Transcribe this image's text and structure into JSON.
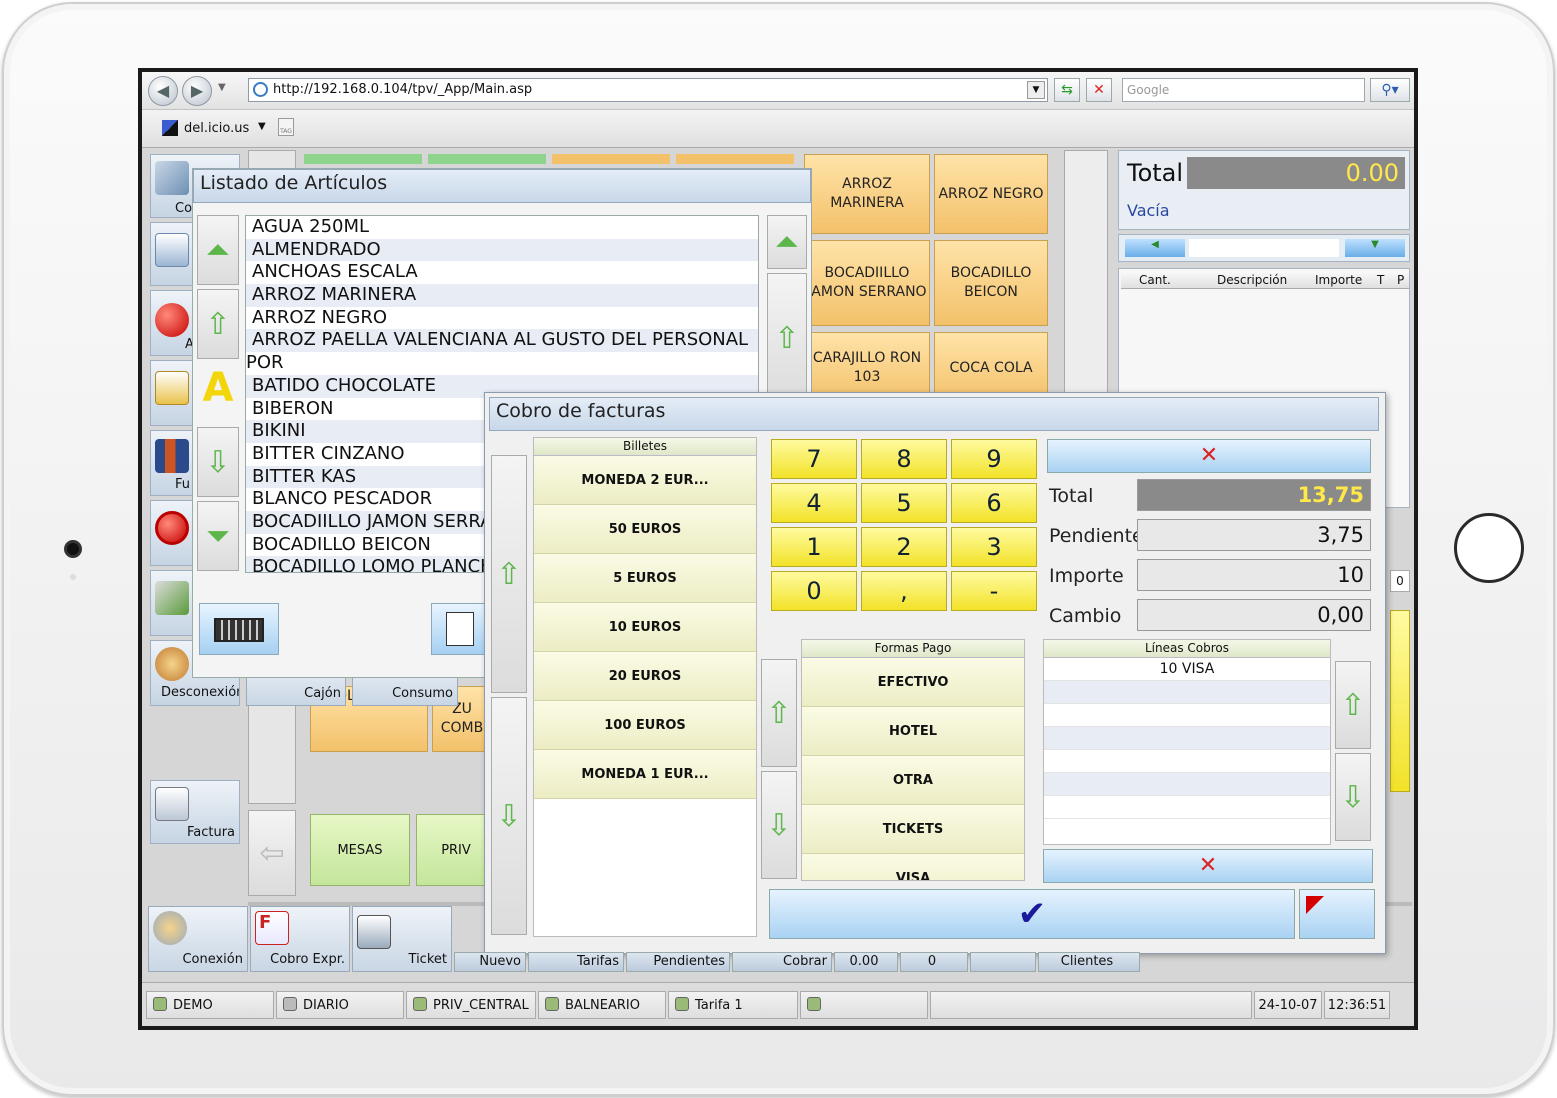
{
  "browser": {
    "url": "http://192.168.0.104/tpv/_App/Main.asp",
    "search_placeholder": "Google",
    "bookmark": "del.icio.us"
  },
  "sidebar": {
    "items": [
      {
        "label": "Co",
        "icon": "edit-icon"
      },
      {
        "label": "",
        "icon": "document-icon"
      },
      {
        "label": "A",
        "icon": "apple-icon"
      },
      {
        "label": "",
        "icon": "coins-icon"
      },
      {
        "label": "Fu",
        "icon": "tools-icon"
      },
      {
        "label": "",
        "icon": "forbidden-apple-icon"
      },
      {
        "label": "",
        "icon": "printer-icon"
      },
      {
        "label": "Desconexión",
        "icon": "disconnect-icon"
      }
    ],
    "factura_label": "Factura",
    "cajon_label": "Cajón",
    "consumo_label": "Consumo"
  },
  "products": {
    "tiles": [
      "ARROZ MARINERA",
      "ARROZ NEGRO",
      "BOCADIILLO JAMON SERRANO",
      "BOCADILLO BEICON",
      "CARAJILLO RON 103",
      "COCA COLA"
    ],
    "partial_tiles": [
      "VOLL DAMM",
      "ZU COMB"
    ],
    "mesas": "MESAS",
    "priv": "PRIV"
  },
  "ticket": {
    "total_label": "Total",
    "total_value": "0.00",
    "status": "Vacía",
    "columns": [
      "Cant.",
      "Descripción",
      "Importe",
      "T",
      "P"
    ],
    "side_value": "0"
  },
  "articles": {
    "title": "Listado de Artículos",
    "letter": "A",
    "items": [
      "AGUA 250ML",
      "ALMENDRADO",
      "ANCHOAS ESCALA",
      "ARROZ MARINERA",
      "ARROZ NEGRO",
      "ARROZ PAELLA VALENCIANA AL GUSTO DEL PERSONAL",
      "POR",
      "BATIDO CHOCOLATE",
      "BIBERON",
      "BIKINI",
      "BITTER CINZANO",
      "BITTER KAS",
      "BLANCO PESCADOR",
      "BOCADIILLO JAMON SERRANO",
      "BOCADILLO BEICON",
      "BOCADILLO LOMO PLANCHA"
    ]
  },
  "payment": {
    "title": "Cobro de facturas",
    "billetes_header": "Billetes",
    "billetes": [
      "MONEDA 2 EUR...",
      "50 EUROS",
      "5 EUROS",
      "10 EUROS",
      "20 EUROS",
      "100 EUROS",
      "MONEDA 1 EUR..."
    ],
    "keypad": [
      "7",
      "8",
      "9",
      "4",
      "5",
      "6",
      "1",
      "2",
      "3",
      "0",
      ",",
      "-"
    ],
    "total_label": "Total",
    "total_value": "13,75",
    "pendiente_label": "Pendiente",
    "pendiente_value": "3,75",
    "importe_label": "Importe",
    "importe_value": "10",
    "cambio_label": "Cambio",
    "cambio_value": "0,00",
    "formas_header": "Formas Pago",
    "formas": [
      "EFECTIVO",
      "HOTEL",
      "OTRA",
      "TICKETS",
      "VISA"
    ],
    "lineas_header": "Líneas Cobros",
    "lineas": [
      "10 VISA"
    ]
  },
  "bottom_bar": {
    "buttons": [
      {
        "label": "Conexión",
        "icon": "user-connect-icon"
      },
      {
        "label": "Cobro Expr.",
        "icon": "visa-invoice-icon"
      },
      {
        "label": "Ticket",
        "icon": "printer-icon"
      }
    ],
    "tabs": [
      "Nuevo",
      "Tarifas",
      "Pendientes",
      "Cobrar",
      "0.00",
      "0",
      "",
      "Clientes"
    ]
  },
  "status_bar": {
    "cells": [
      "DEMO",
      "DIARIO",
      "PRIV_CENTRAL",
      "BALNEARIO",
      "Tarifa 1",
      "",
      "",
      "24-10-07",
      "12:36:51"
    ]
  },
  "colors": {
    "accent_yellow": "#f2e228",
    "tile_orange": "#f3c16a",
    "tile_green": "#c4e69a",
    "total_text": "#ffe84a",
    "window_blue": "#c8d7e9"
  }
}
